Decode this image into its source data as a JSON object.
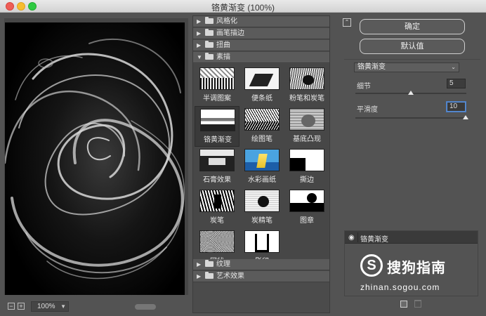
{
  "window": {
    "title": "铬黄渐变 (100%)"
  },
  "preview": {
    "zoom": "100%"
  },
  "gallery": {
    "categories_top": [
      {
        "label": "风格化",
        "expanded": false
      },
      {
        "label": "画笔描边",
        "expanded": false
      },
      {
        "label": "扭曲",
        "expanded": false
      },
      {
        "label": "素描",
        "expanded": true
      }
    ],
    "filters": [
      {
        "label": "半调图案",
        "selected": false
      },
      {
        "label": "便条纸",
        "selected": false
      },
      {
        "label": "粉笔和炭笔",
        "selected": false
      },
      {
        "label": "铬黄渐变",
        "selected": true
      },
      {
        "label": "绘图笔",
        "selected": false
      },
      {
        "label": "基底凸现",
        "selected": false
      },
      {
        "label": "石膏效果",
        "selected": false
      },
      {
        "label": "水彩画纸",
        "selected": false
      },
      {
        "label": "撕边",
        "selected": false
      },
      {
        "label": "炭笔",
        "selected": false
      },
      {
        "label": "炭精笔",
        "selected": false
      },
      {
        "label": "图章",
        "selected": false
      },
      {
        "label": "网状",
        "selected": false
      },
      {
        "label": "影印",
        "selected": false
      }
    ],
    "categories_bottom": [
      {
        "label": "纹理",
        "expanded": false
      },
      {
        "label": "艺术效果",
        "expanded": false
      }
    ]
  },
  "buttons": {
    "ok": "确定",
    "default": "默认值"
  },
  "settings": {
    "filter": "铬黄渐变",
    "params": [
      {
        "label": "细节",
        "value": "5",
        "level": 0.5
      },
      {
        "label": "平滑度",
        "value": "10",
        "level": 1.0
      }
    ]
  },
  "layers": [
    {
      "name": "铬黄渐变",
      "visible": true
    }
  ],
  "watermark": {
    "brand": "搜狗指南",
    "url": "zhinan.sogou.com",
    "logo_letter": "S"
  },
  "icons": [
    "eye-icon",
    "folder-icon",
    "zoom-in-icon",
    "zoom-out-icon",
    "new-layer-icon",
    "delete-layer-icon",
    "collapse-icon"
  ]
}
